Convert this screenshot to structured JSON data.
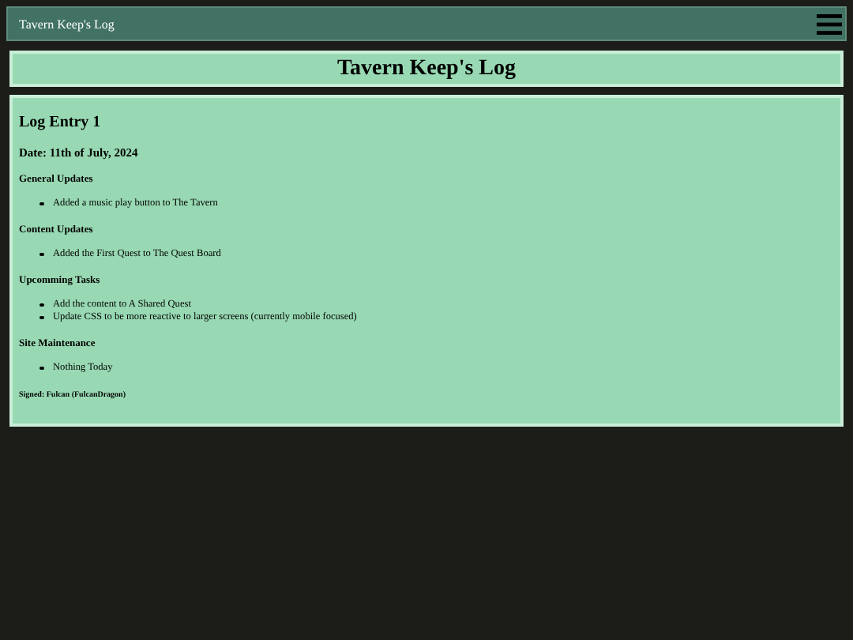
{
  "navbar": {
    "title": "Tavern Keep's Log"
  },
  "page_title": "Tavern Keep's Log",
  "entry": {
    "title": "Log Entry 1",
    "date": "Date: 11th of July, 2024",
    "sections": [
      {
        "heading": "General Updates",
        "items": [
          "Added a music play button to The Tavern"
        ]
      },
      {
        "heading": "Content Updates",
        "items": [
          "Added the First Quest to The Quest Board"
        ]
      },
      {
        "heading": "Upcomming Tasks",
        "items": [
          "Add the content to A Shared Quest",
          "Update CSS to be more reactive to larger screens (currently mobile focused)"
        ]
      },
      {
        "heading": "Site Maintenance",
        "items": [
          "Nothing Today"
        ]
      }
    ],
    "signature": "Signed: Fulcan (FulcanDragon)"
  }
}
